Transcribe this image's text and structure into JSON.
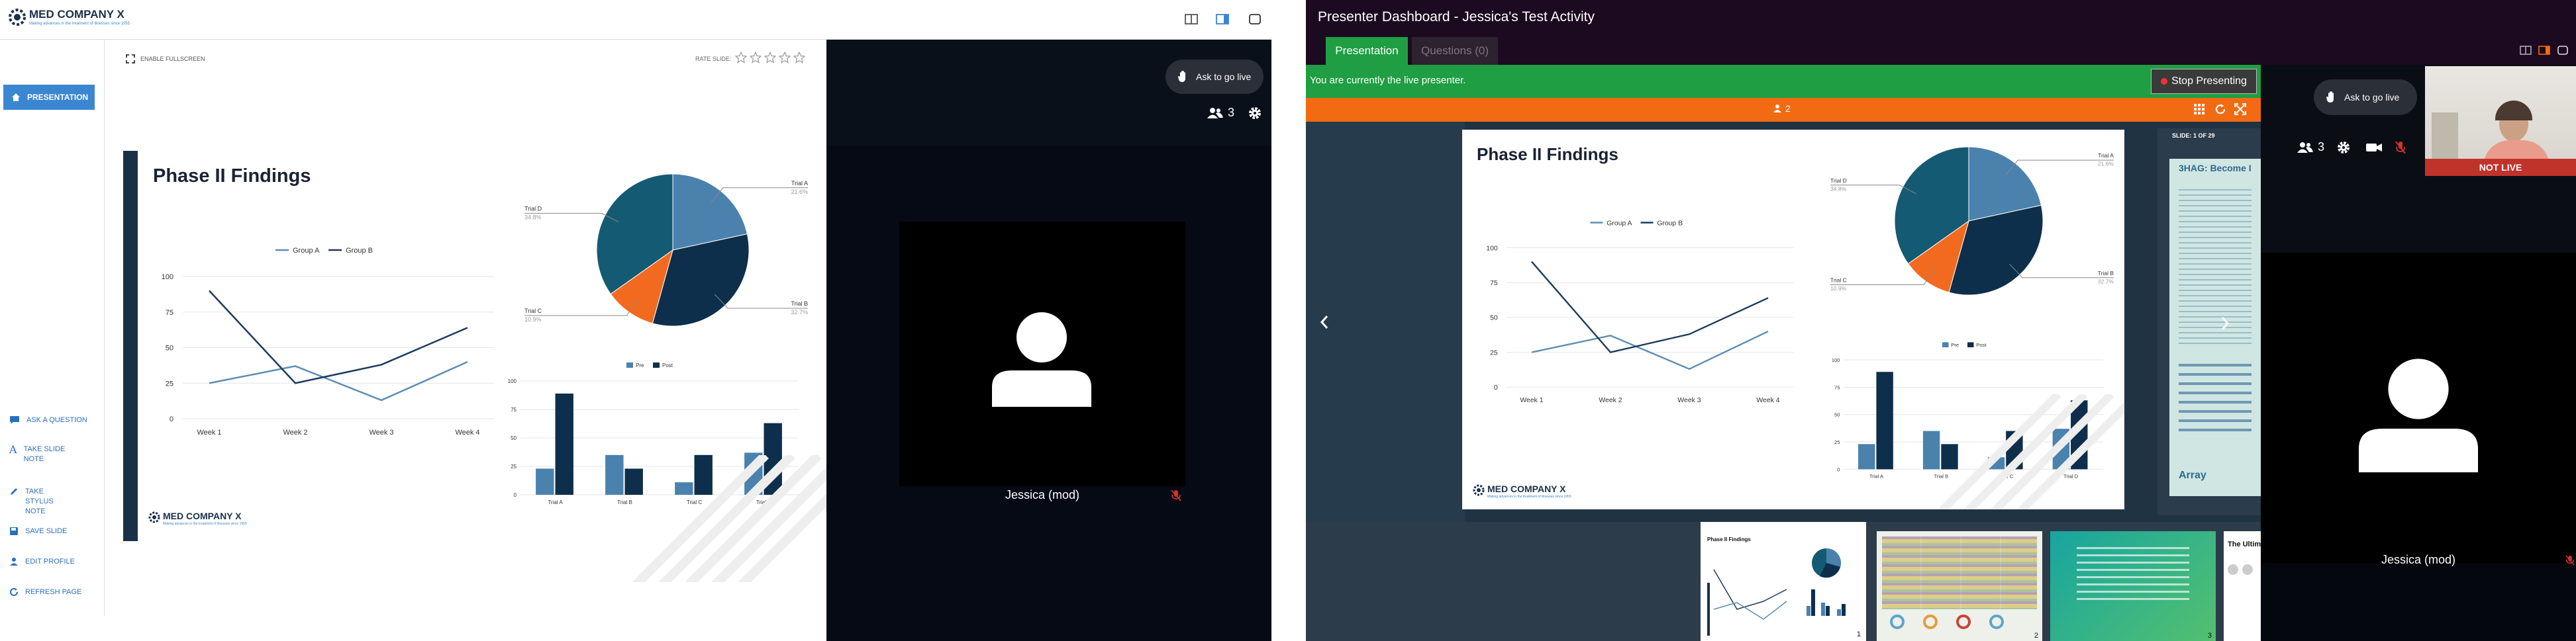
{
  "left_app": {
    "logo": {
      "name": "MED COMPANY X",
      "tagline": "Making advances in the treatment of illnesses since 1955"
    },
    "nav": {
      "presentation": "PRESENTATION",
      "ask_question": "ASK A QUESTION",
      "take_slide_note": "TAKE SLIDE NOTE",
      "take_stylus_note": "TAKE STYLUS NOTE",
      "save_slide": "SAVE SLIDE",
      "edit_profile": "EDIT PROFILE",
      "refresh_page": "REFRESH PAGE"
    },
    "enable_fullscreen": "ENABLE FULLSCREEN",
    "rate_slide": "RATE SLIDE:",
    "rating_stars": 0,
    "ask_to_go_live": "Ask to go live",
    "participants_count": "3",
    "camera_name": "Jessica (mod)"
  },
  "slide": {
    "title": "Phase II Findings",
    "footer_logo": "MED COMPANY X",
    "footer_tagline": "Making advances in the treatment of illnesses since 1955"
  },
  "chart_data": [
    {
      "type": "line",
      "title": "",
      "categories": [
        "Week 1",
        "Week 2",
        "Week 3",
        "Week 4"
      ],
      "series": [
        {
          "name": "Group A",
          "values": [
            25,
            37,
            13,
            40
          ],
          "color": "#5b8db5"
        },
        {
          "name": "Group B",
          "values": [
            90,
            25,
            38,
            64
          ],
          "color": "#1d3a5c"
        }
      ],
      "ylim": [
        0,
        100
      ],
      "yticks": [
        0,
        25,
        50,
        75,
        100
      ],
      "legend": "top"
    },
    {
      "type": "pie",
      "slices": [
        {
          "label": "Trial A",
          "sublabel": "21.6%",
          "value": 21.6,
          "color": "#4a82ad"
        },
        {
          "label": "Trial B",
          "sublabel": "32.7%",
          "value": 32.7,
          "color": "#0e2f4b"
        },
        {
          "label": "Trial C",
          "sublabel": "10.9%",
          "value": 10.9,
          "color": "#f26a1f"
        },
        {
          "label": "Trial D",
          "sublabel": "34.8%",
          "value": 34.8,
          "color": "#155a73"
        }
      ]
    },
    {
      "type": "bar",
      "categories": [
        "Trial A",
        "Trial B",
        "Trial C",
        "Trial D"
      ],
      "series": [
        {
          "name": "Pre",
          "values": [
            23,
            35,
            11,
            37
          ],
          "color": "#4a82ad"
        },
        {
          "name": "Post",
          "values": [
            89,
            23,
            35,
            63
          ],
          "color": "#0e2f4b"
        }
      ],
      "ylim": [
        0,
        100
      ],
      "yticks": [
        0,
        25,
        50,
        75,
        100
      ],
      "legend": "top"
    }
  ],
  "right_app": {
    "window_title": "Presenter Dashboard - Jessica's Test Activity",
    "tabs": [
      {
        "label": "Presentation"
      },
      {
        "label": "Questions (0)"
      }
    ],
    "live_message": "You are currently the live presenter.",
    "stop_presenting": "Stop Presenting",
    "viewer_count": "2",
    "slide_indicator": "SLIDE: 1 OF 29",
    "next_slide_title": "3HAG: Become I",
    "ask_to_go_live": "Ask to go live",
    "participants_count": "3",
    "not_live": "NOT LIVE",
    "camera_name": "Jessica (mod)",
    "thumbnails": [
      {
        "number": "1",
        "title": "Phase II Findings"
      },
      {
        "number": "2",
        "title": ""
      },
      {
        "number": "3",
        "title": ""
      },
      {
        "number": "",
        "title": "The Ultim"
      }
    ],
    "colors": {
      "green": "#1f9e43",
      "orange": "#f26a12",
      "purple": "#1c0b20"
    }
  }
}
